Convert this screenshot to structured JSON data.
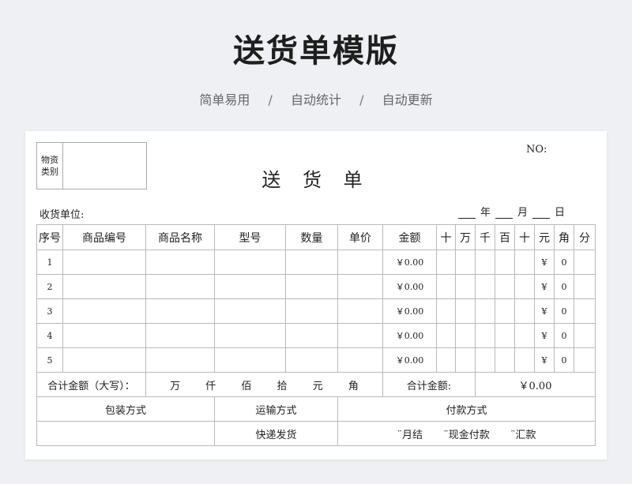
{
  "hero": {
    "title": "送货单模版",
    "features": [
      "简单易用",
      "自动统计",
      "自动更新"
    ],
    "separator": "/"
  },
  "form": {
    "category_label": "物资类别",
    "title": "送 货 单",
    "no_label": "NO:",
    "receiver_label": "收货单位:",
    "date_units": [
      "年",
      "月",
      "日"
    ],
    "columns": [
      "序号",
      "商品编号",
      "商品名称",
      "型号",
      "数量",
      "单价",
      "金额"
    ],
    "digit_columns": [
      "十",
      "万",
      "千",
      "百",
      "十",
      "元",
      "角",
      "分"
    ],
    "rows": [
      {
        "index": "1",
        "amount": "￥0.00",
        "yuan": "¥",
        "jiao": "0"
      },
      {
        "index": "2",
        "amount": "￥0.00",
        "yuan": "¥",
        "jiao": "0"
      },
      {
        "index": "3",
        "amount": "￥0.00",
        "yuan": "¥",
        "jiao": "0"
      },
      {
        "index": "4",
        "amount": "￥0.00",
        "yuan": "¥",
        "jiao": "0"
      },
      {
        "index": "5",
        "amount": "￥0.00",
        "yuan": "¥",
        "jiao": "0"
      }
    ],
    "total_upper_label": "合计金额（大写）：",
    "upper_units": [
      "万",
      "仟",
      "佰",
      "拾",
      "元",
      "角"
    ],
    "total_label": "合计金额:",
    "total_value": "￥0.00",
    "packing_label": "包装方式",
    "transport_label": "运输方式",
    "payment_label": "付款方式",
    "transport_value": "快递发货",
    "payment_options": [
      "¨月结",
      "¨现金付款",
      "¨汇款"
    ]
  }
}
